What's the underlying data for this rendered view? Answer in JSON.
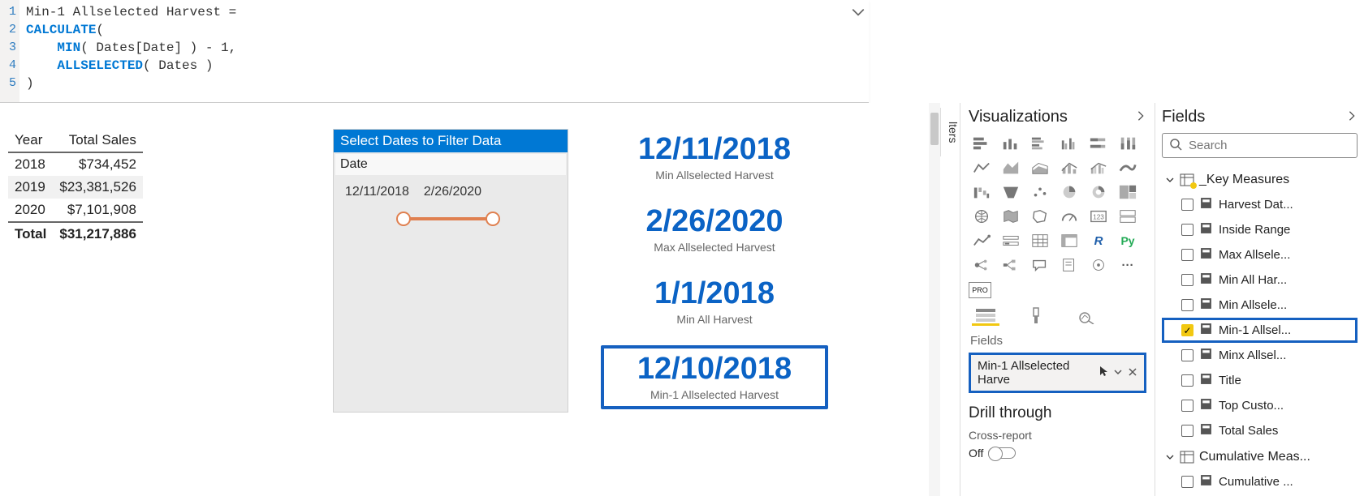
{
  "formula": {
    "lines": [
      "1",
      "2",
      "3",
      "4",
      "5"
    ],
    "l1a": "Min-1 Allselected Harvest ",
    "l1b": "=",
    "l2a": "CALCULATE",
    "l2b": "(",
    "l3a": "    MIN",
    "l3b": "( Dates[Date] ) - 1,",
    "l4a": "    ALLSELECTED",
    "l4b": "( Dates )",
    "l5": ")"
  },
  "salesTable": {
    "col1": "Year",
    "col2": "Total Sales",
    "r1y": "2018",
    "r1v": "$734,452",
    "r2y": "2019",
    "r2v": "$23,381,526",
    "r3y": "2020",
    "r3v": "$7,101,908",
    "totLbl": "Total",
    "totVal": "$31,217,886"
  },
  "slicer": {
    "title": "Select Dates to Filter Data",
    "sub": "Date",
    "d1": "12/11/2018",
    "d2": "2/26/2020"
  },
  "cards": {
    "c1v": "12/11/2018",
    "c1l": "Min Allselected Harvest",
    "c2v": "2/26/2020",
    "c2l": "Max Allselected Harvest",
    "c3v": "1/1/2018",
    "c3l": "Min All Harvest",
    "c4v": "12/10/2018",
    "c4l": "Min-1 Allselected Harvest"
  },
  "filtersTab": "lters",
  "viz": {
    "header": "Visualizations",
    "fieldsLabel": "Fields",
    "wellField": "Min-1 Allselected Harve",
    "drill": "Drill through",
    "cross": "Cross-report",
    "off": "Off",
    "proBadge": "PRO",
    "rLabel": "R",
    "pyLabel": "Py",
    "ellipsis": "···"
  },
  "fields": {
    "header": "Fields",
    "searchPlaceholder": "Search",
    "group1": "_Key Measures",
    "items1": {
      "i0": "Harvest Dat...",
      "i1": "Inside Range",
      "i2": "Max Allsele...",
      "i3": "Min All Har...",
      "i4": "Min Allsele...",
      "i5": "Min-1 Allsel...",
      "i6": "Minx Allsel...",
      "i7": "Title",
      "i8": "Top Custo...",
      "i9": "Total Sales"
    },
    "group2": "Cumulative Meas...",
    "items2": {
      "i0": "Cumulative ..."
    }
  }
}
